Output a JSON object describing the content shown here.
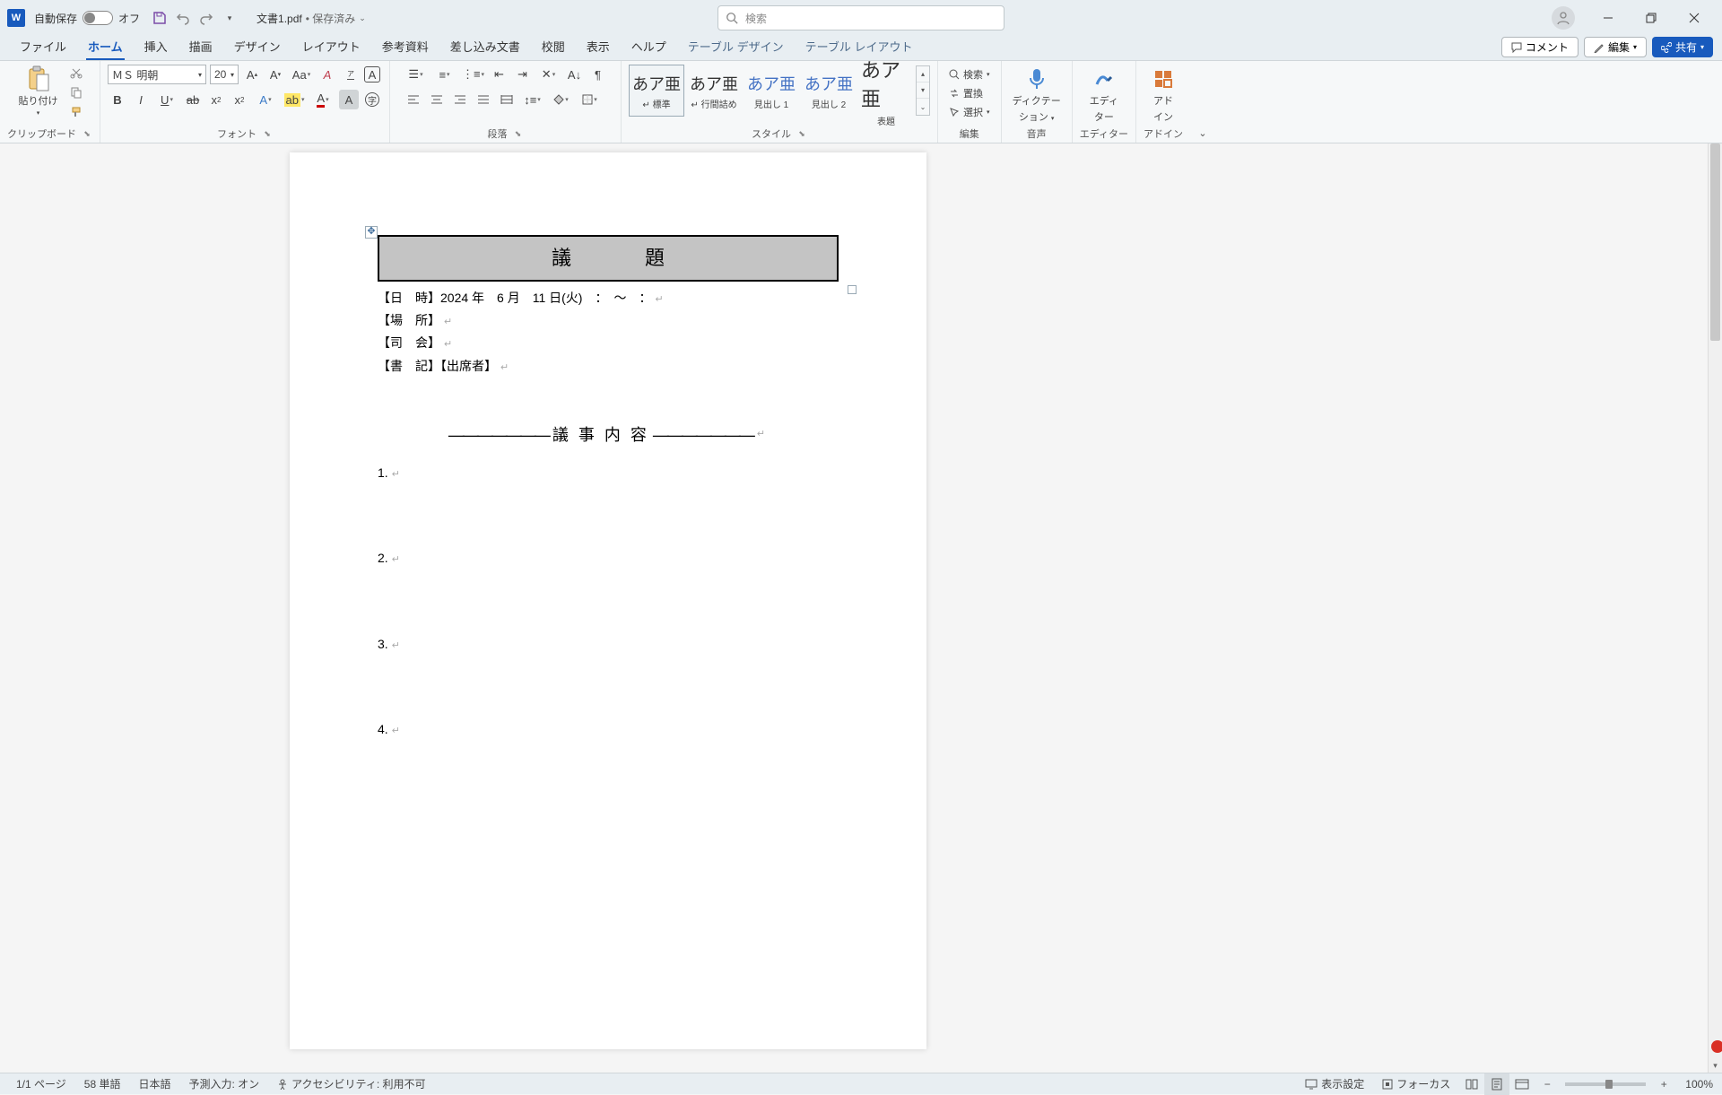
{
  "titlebar": {
    "word_icon_text": "W",
    "autosave_label": "自動保存",
    "autosave_state": "オフ",
    "doc_name": "文書1.pdf",
    "saved_status": "• 保存済み",
    "search_placeholder": "検索"
  },
  "tabs": {
    "file": "ファイル",
    "home": "ホーム",
    "insert": "挿入",
    "draw": "描画",
    "design": "デザイン",
    "layout": "レイアウト",
    "references": "参考資料",
    "mailings": "差し込み文書",
    "review": "校閲",
    "view": "表示",
    "help": "ヘルプ",
    "table_design": "テーブル デザイン",
    "table_layout": "テーブル レイアウト",
    "comment_btn": "コメント",
    "edit_btn": "編集",
    "share_btn": "共有"
  },
  "ribbon": {
    "clipboard": {
      "paste": "貼り付け",
      "label": "クリップボード"
    },
    "font": {
      "name": "ＭＳ 明朝",
      "size": "20",
      "label": "フォント"
    },
    "paragraph": {
      "label": "段落"
    },
    "styles": {
      "preview": "あア亜",
      "normal": "標準",
      "nospacing": "行間詰め",
      "heading1": "見出し 1",
      "heading2": "見出し 2",
      "title": "表題",
      "label": "スタイル"
    },
    "editing": {
      "find": "検索",
      "replace": "置換",
      "select": "選択",
      "label": "編集"
    },
    "dictate": {
      "line1": "ディクテー",
      "line2": "ション",
      "label": "音声"
    },
    "editor": {
      "line1": "エディ",
      "line2": "ター",
      "label": "エディター"
    },
    "addins": {
      "line1": "アド",
      "line2": "イン",
      "label": "アドイン"
    }
  },
  "document": {
    "title_cell": "議　題",
    "date_line": "【日　時】2024 年　6 月　11 日(火)　：　〜　：",
    "place_line": "【場　所】",
    "chair_line": "【司　会】",
    "recorder_line": "【書　記】【出席者】",
    "section_head": "議 事 内 容",
    "dashes": "―――――――",
    "items": [
      "1.",
      "2.",
      "3.",
      "4."
    ]
  },
  "statusbar": {
    "page": "1/1 ページ",
    "words": "58 単語",
    "language": "日本語",
    "ime": "予測入力: オン",
    "accessibility": "アクセシビリティ: 利用不可",
    "display_settings": "表示設定",
    "focus": "フォーカス",
    "zoom": "100%"
  }
}
